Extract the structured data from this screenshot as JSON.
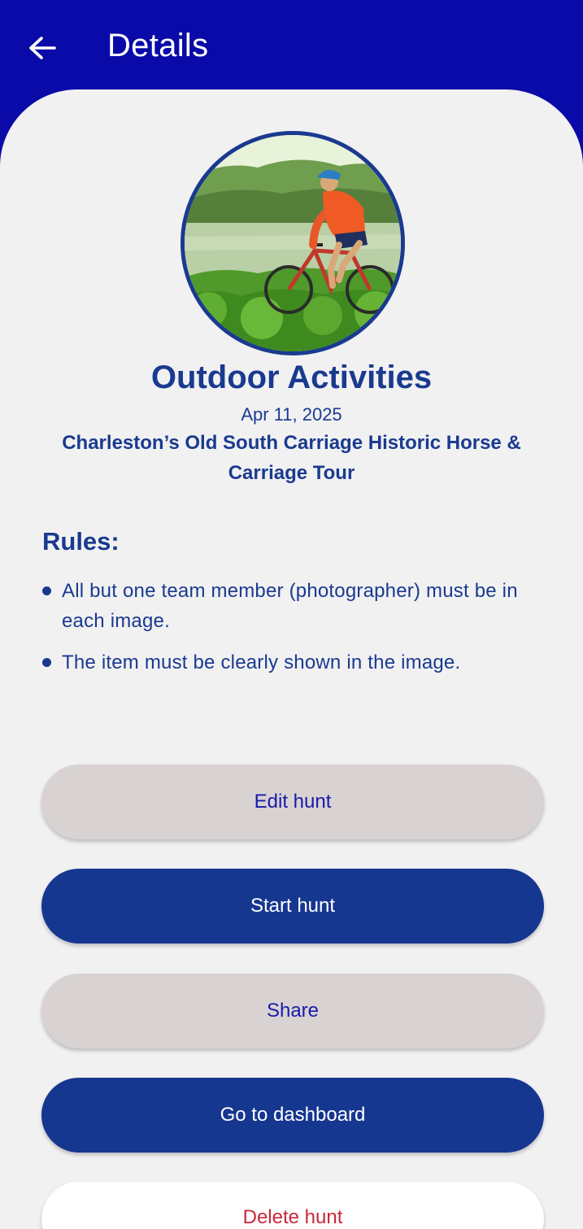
{
  "appbar": {
    "title": "Details",
    "back_icon": "arrow-left-icon"
  },
  "hunt": {
    "image_icon": "cyclist-photo",
    "title": "Outdoor Activities",
    "date": "Apr 11, 2025",
    "location": "Charleston’s Old South Carriage Historic Horse & Carriage Tour"
  },
  "rules": {
    "heading": "Rules:",
    "items": [
      "All but one team member (photographer) must be in each image.",
      "The item must be clearly shown in the image."
    ]
  },
  "actions": {
    "edit_label": "Edit hunt",
    "start_label": "Start hunt",
    "share_label": "Share",
    "dashboard_label": "Go to dashboard",
    "delete_label": "Delete hunt"
  },
  "colors": {
    "appbar_bg": "#0a0aa8",
    "primary": "#163790",
    "text": "#1a3a8f",
    "light_button": "#d8d2d3",
    "danger": "#c8283a",
    "background": "#f1f1f2"
  }
}
